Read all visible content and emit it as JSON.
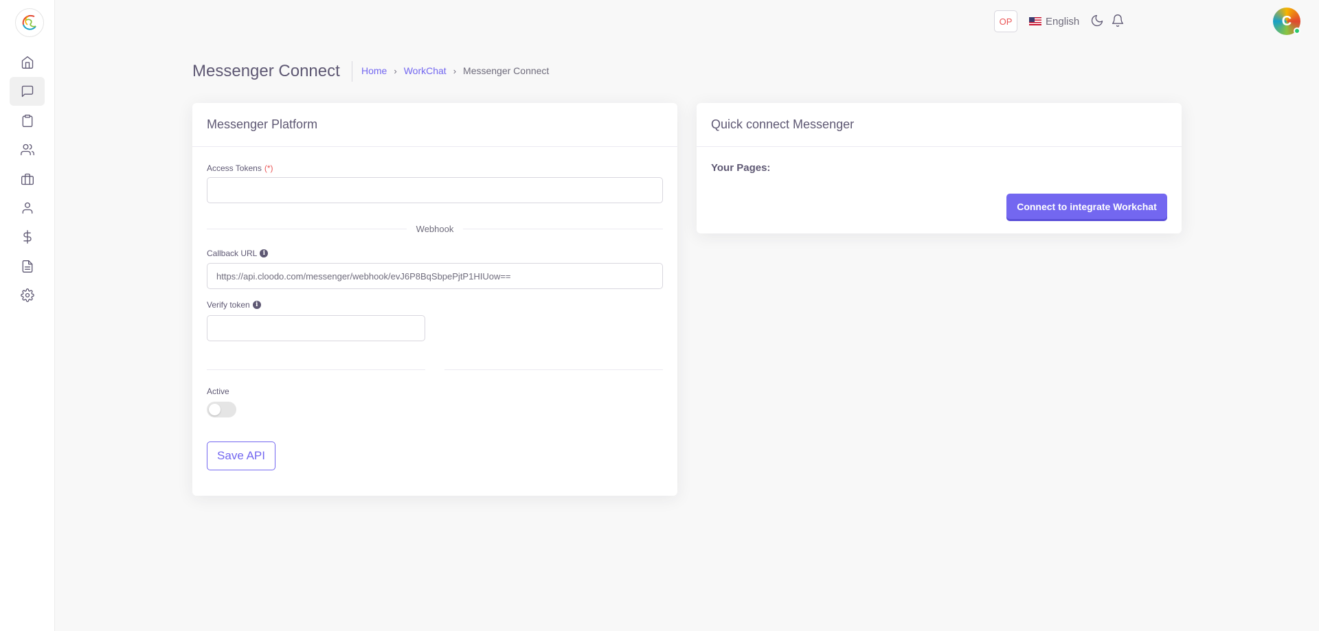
{
  "header": {
    "op_badge": "OP",
    "language": "English"
  },
  "page": {
    "title": "Messenger Connect",
    "breadcrumb": [
      "Home",
      "WorkChat",
      "Messenger Connect"
    ]
  },
  "platform_card": {
    "title": "Messenger Platform",
    "access_tokens_label": "Access Tokens",
    "required_mark": "(*)",
    "access_tokens_value": "",
    "webhook_divider": "Webhook",
    "callback_url_label": "Callback URL",
    "callback_url_value": "https://api.cloodo.com/messenger/webhook/evJ6P8BqSbpePjtP1HIUow==",
    "verify_token_label": "Verify token",
    "verify_token_value": "",
    "active_label": "Active",
    "active": false,
    "save_button": "Save API"
  },
  "quick_card": {
    "title": "Quick connect Messenger",
    "pages_label": "Your Pages:",
    "connect_button": "Connect to integrate Workchat"
  },
  "colors": {
    "primary": "#7367f0",
    "danger": "#ea5455",
    "online": "#28c76f"
  },
  "sidebar_icons": [
    "home-icon",
    "chat-icon",
    "clipboard-icon",
    "users-icon",
    "briefcase-icon",
    "user-icon",
    "dollar-icon",
    "file-text-icon",
    "settings-icon"
  ]
}
